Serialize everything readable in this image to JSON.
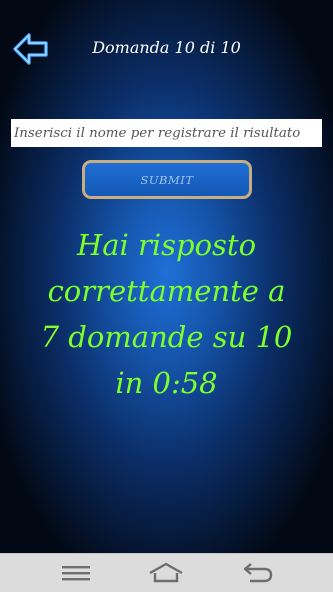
{
  "header": {
    "back_icon": "arrow-left-icon",
    "title": "Domanda 10 di 10"
  },
  "form": {
    "name_placeholder": "Inserisci il nome per registrare il risultato",
    "name_value": "",
    "submit_label": "SUBMIT"
  },
  "result": {
    "lines": [
      "Hai risposto",
      "correttamente a",
      "7 domande su 10",
      "in 0:58"
    ],
    "correct_answers": 7,
    "total_questions": 10,
    "time": "0:58"
  },
  "navbar": {
    "menu_icon": "menu-icon",
    "home_icon": "home-icon",
    "back_icon": "back-icon"
  },
  "colors": {
    "result_text": "#7cff2a",
    "submit_bg": "#1a64c6",
    "submit_border": "#c9ad82",
    "background_center": "#1f6fd8"
  }
}
